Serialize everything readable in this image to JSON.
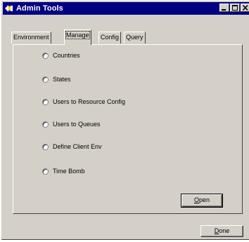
{
  "window": {
    "title": "Admin Tools"
  },
  "tabs": [
    {
      "label": "Environment"
    },
    {
      "label": "Manage"
    },
    {
      "label": "Config"
    },
    {
      "label": "Query"
    }
  ],
  "active_tab": "Manage",
  "options": [
    {
      "label": "Countries"
    },
    {
      "label": "States"
    },
    {
      "label": "Users to Resource Config"
    },
    {
      "label": "Users to Queues"
    },
    {
      "label": "Define Client Env"
    },
    {
      "label": "Time Bomb"
    }
  ],
  "buttons": {
    "open": {
      "mnemonic": "O",
      "rest": "pen"
    },
    "done": {
      "mnemonic": "D",
      "rest": "one"
    }
  },
  "icons": {
    "app": "app-icon",
    "minimize": "minimize-icon",
    "maximize": "maximize-icon",
    "close": "close-icon"
  },
  "colors": {
    "titlebar": "#000080",
    "face": "#d4d0c8"
  }
}
